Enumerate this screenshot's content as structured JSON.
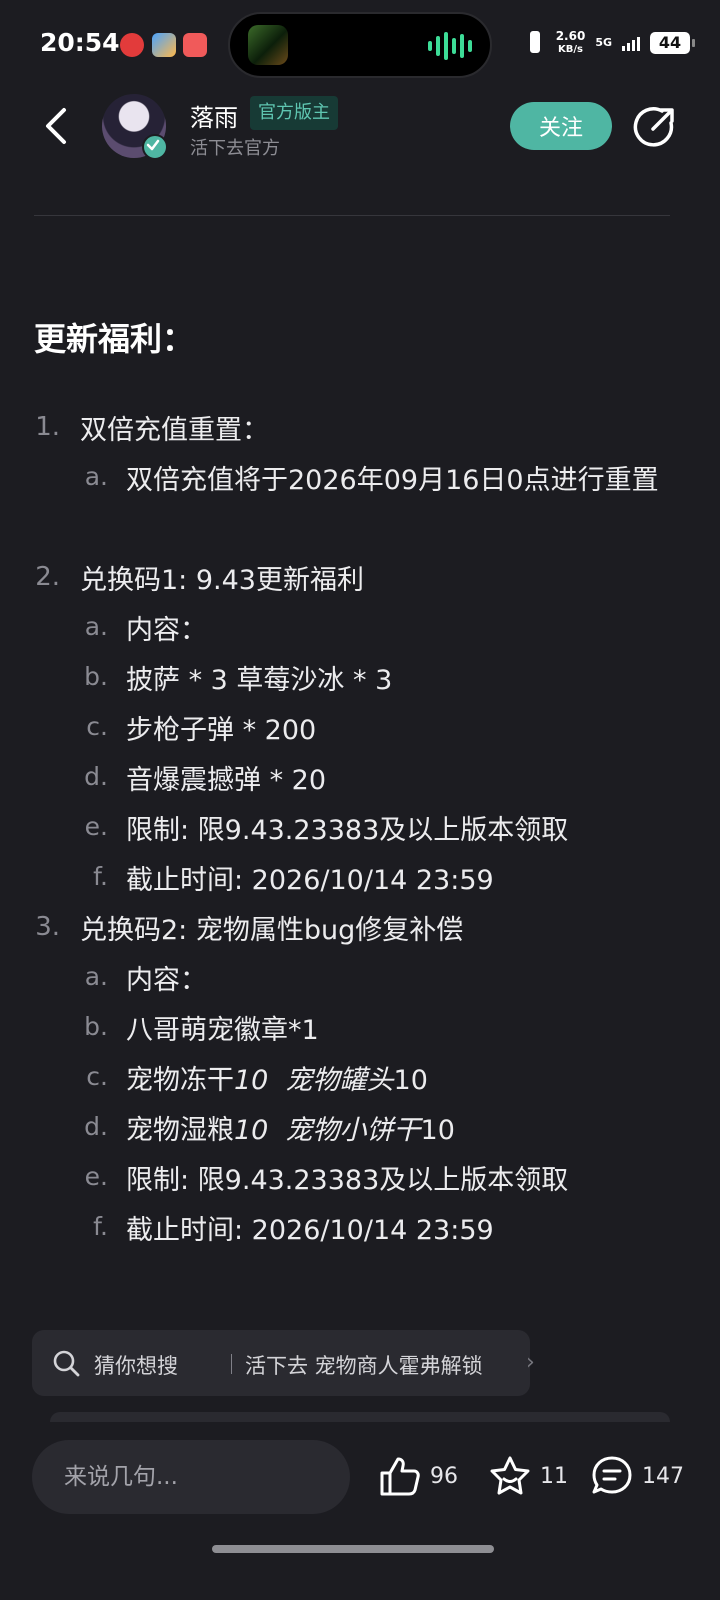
{
  "status_bar": {
    "time": "20:54",
    "speed_value": "2.60",
    "speed_unit": "KB/s",
    "network": "5G",
    "battery": "44"
  },
  "author": {
    "name": "落雨",
    "badge": "官方版主",
    "subtitle": "活下去官方"
  },
  "header": {
    "follow_label": "关注"
  },
  "post": {
    "heading": "更新福利：",
    "items": [
      {
        "num": "1.",
        "text": "双倍充值重置：",
        "subs": [
          {
            "letter": "a.",
            "text": "双倍充值将于2026年09月16日0点进行重置"
          }
        ]
      },
      {
        "num": "2.",
        "text": "兑换码1: 9.43更新福利",
        "subs": [
          {
            "letter": "a.",
            "text": "内容："
          },
          {
            "letter": "b.",
            "text": "披萨 * 3 草莓沙冰 * 3"
          },
          {
            "letter": "c.",
            "text": "步枪子弹 * 200"
          },
          {
            "letter": "d.",
            "text": "音爆震撼弹 * 20"
          },
          {
            "letter": "e.",
            "text": "限制: 限9.43.23383及以上版本领取"
          },
          {
            "letter": "f.",
            "text": "截止时间: 2026/10/14 23:59"
          }
        ]
      },
      {
        "num": "3.",
        "text": "兑换码2: 宠物属性bug修复补偿",
        "subs": [
          {
            "letter": "a.",
            "text": "内容："
          },
          {
            "letter": "b.",
            "text": "八哥萌宠徽章*1"
          },
          {
            "letter": "c.",
            "text_normal": "宠物冻干",
            "text_italic": "10  宠物罐头",
            "text_tail": "10"
          },
          {
            "letter": "d.",
            "text_normal": "宠物湿粮",
            "text_italic": "10  宠物小饼干",
            "text_tail": "10"
          },
          {
            "letter": "e.",
            "text": "限制: 限9.43.23383及以上版本领取"
          },
          {
            "letter": "f.",
            "text": "截止时间: 2026/10/14 23:59"
          }
        ]
      }
    ]
  },
  "search_suggest": {
    "label": "猜你想搜",
    "query": "活下去 宠物商人霍弗解锁"
  },
  "bottom_bar": {
    "comment_placeholder": "来说几句...",
    "likes": "96",
    "favorites": "11",
    "comments": "147"
  }
}
